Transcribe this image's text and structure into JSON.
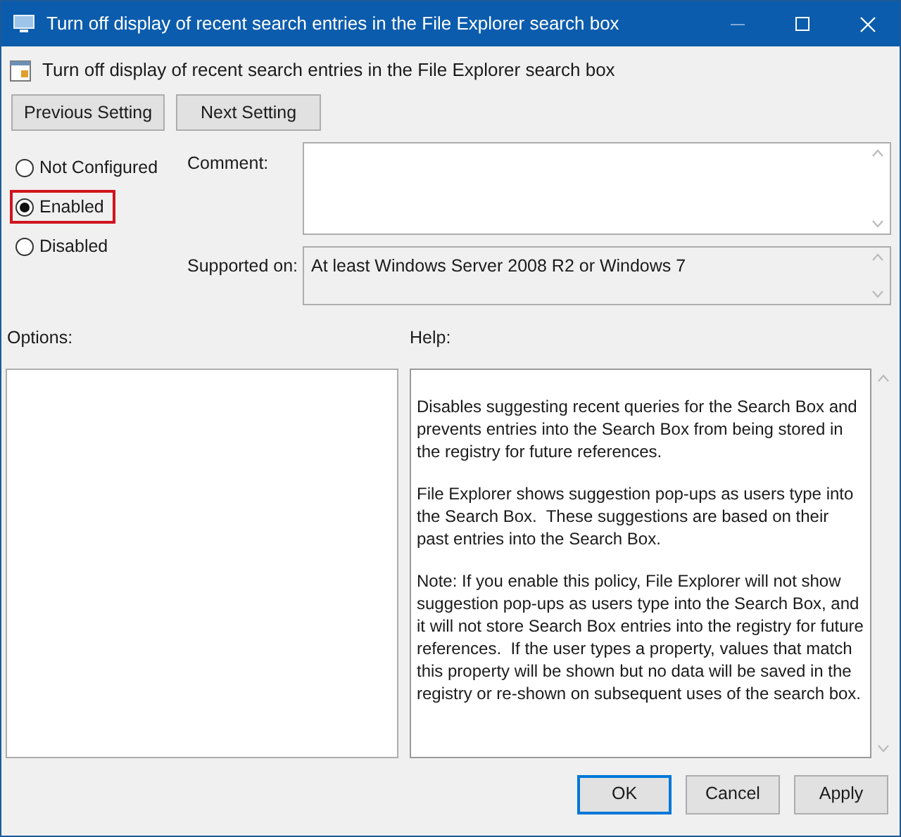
{
  "window": {
    "title": "Turn off display of recent search entries in the File Explorer search box"
  },
  "header": {
    "title": "Turn off display of recent search entries in the File Explorer search box"
  },
  "nav_buttons": [
    "Previous Setting",
    "Next Setting"
  ],
  "options": [
    {
      "label": "Not Configured",
      "selected": false,
      "highlighted": false
    },
    {
      "label": "Enabled",
      "selected": true,
      "highlighted": true
    },
    {
      "label": "Disabled",
      "selected": false,
      "highlighted": false
    }
  ],
  "comment": {
    "label": "Comment:"
  },
  "supported_on": {
    "label": "Supported on:",
    "value": "At least Windows Server 2008 R2 or Windows 7"
  },
  "options_panel": {
    "label": "Options:"
  },
  "help_panel": {
    "label": "Help:",
    "paragraphs": [
      "Disables suggesting recent queries for the Search Box and prevents entries into the Search Box from being stored in the registry for future references.",
      "File Explorer shows suggestion pop-ups as users type into the Search Box.  These suggestions are based on their past entries into the Search Box.",
      "Note: If you enable this policy, File Explorer will not show suggestion pop-ups as users type into the Search Box, and it will not store Search Box entries into the registry for future references.  If the user types a property, values that match this property will be shown but no data will be saved in the registry or re-shown on subsequent uses of the search box."
    ]
  },
  "buttons": [
    {
      "label": "OK",
      "kind": "default"
    },
    {
      "label": "Cancel",
      "kind": "normal"
    },
    {
      "label": "Apply",
      "kind": "normal"
    }
  ]
}
